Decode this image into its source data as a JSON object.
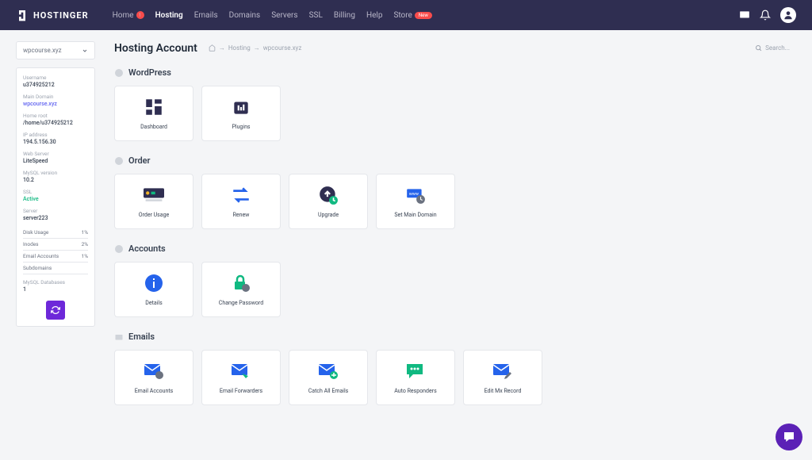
{
  "brand": "HOSTINGER",
  "nav": {
    "items": [
      {
        "label": "Home",
        "badge": "1"
      },
      {
        "label": "Hosting",
        "active": true
      },
      {
        "label": "Emails"
      },
      {
        "label": "Domains"
      },
      {
        "label": "Servers"
      },
      {
        "label": "SSL"
      },
      {
        "label": "Billing"
      },
      {
        "label": "Help"
      },
      {
        "label": "Store",
        "new": true
      }
    ]
  },
  "dropdown": {
    "label": "wpcourse.xyz"
  },
  "info": {
    "username_label": "Username",
    "username": "u374925212",
    "maindomain_label": "Main Domain",
    "maindomain": "wpcourse.xyz",
    "homeroot_label": "Home root",
    "homeroot": "/home/u374925212",
    "ip_label": "IP address",
    "ip": "194.5.156.30",
    "webserver_label": "Web Server",
    "webserver": "LiteSpeed",
    "mysql_label": "MySQL version",
    "mysql": "10.2",
    "ssl_label": "SSL",
    "ssl": "Active",
    "server_label": "Server",
    "server": "server223"
  },
  "usage": {
    "disk_label": "Disk Usage",
    "disk": "1%",
    "inodes_label": "Inodes",
    "inodes": "2%",
    "email_label": "Email Accounts",
    "email": "1%",
    "sub_label": "Subdomains",
    "sub": "",
    "dbs_label": "MySQL Databases",
    "dbs": "1"
  },
  "page": {
    "title": "Hosting Account"
  },
  "crumb": {
    "c1": "Hosting",
    "c2": "wpcourse.xyz"
  },
  "search": {
    "placeholder": "Search..."
  },
  "sections": {
    "wordpress": {
      "title": "WordPress",
      "cards": [
        {
          "label": "Dashboard"
        },
        {
          "label": "Plugins"
        }
      ]
    },
    "order": {
      "title": "Order",
      "cards": [
        {
          "label": "Order Usage"
        },
        {
          "label": "Renew"
        },
        {
          "label": "Upgrade"
        },
        {
          "label": "Set Main Domain"
        }
      ]
    },
    "accounts": {
      "title": "Accounts",
      "cards": [
        {
          "label": "Details"
        },
        {
          "label": "Change Password"
        }
      ]
    },
    "emails": {
      "title": "Emails",
      "cards": [
        {
          "label": "Email Accounts"
        },
        {
          "label": "Email Forwarders"
        },
        {
          "label": "Catch All Emails"
        },
        {
          "label": "Auto Responders"
        },
        {
          "label": "Edit Mx Record"
        }
      ]
    }
  }
}
